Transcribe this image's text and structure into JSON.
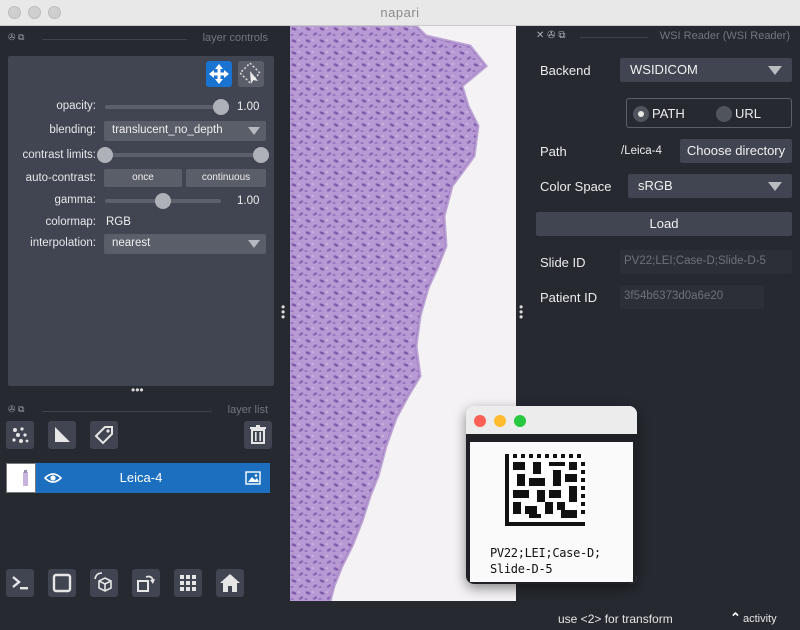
{
  "window": {
    "title": "napari"
  },
  "left_panel": {
    "layer_controls_title": "layer controls",
    "opacity": {
      "label": "opacity:",
      "value_text": "1.00",
      "value": 1.0
    },
    "blending": {
      "label": "blending:",
      "value": "translucent_no_depth"
    },
    "contrast_limits": {
      "label": "contrast limits:",
      "low": 0.0,
      "high": 1.0
    },
    "auto_contrast": {
      "label": "auto-contrast:",
      "once_label": "once",
      "continuous_label": "continuous"
    },
    "gamma": {
      "label": "gamma:",
      "value_text": "1.00",
      "value": 0.5
    },
    "colormap": {
      "label": "colormap:",
      "value": "RGB"
    },
    "interpolation": {
      "label": "interpolation:",
      "value": "nearest"
    },
    "layer_list_title": "layer list",
    "layers": [
      {
        "name": "Leica-4"
      }
    ]
  },
  "right_panel": {
    "title": "WSI Reader (WSI Reader)",
    "backend": {
      "label": "Backend",
      "value": "WSIDICOM"
    },
    "source_options": [
      {
        "label": "PATH",
        "selected": true
      },
      {
        "label": "URL",
        "selected": false
      }
    ],
    "path": {
      "label": "Path",
      "value": "/Leica-4",
      "button_label": "Choose directory"
    },
    "color_space": {
      "label": "Color Space",
      "value": "sRGB"
    },
    "load_button_label": "Load",
    "slide_id": {
      "label": "Slide ID",
      "value": "PV22;LEI;Case-D;Slide-D-5"
    },
    "patient_id": {
      "label": "Patient ID",
      "value": "3f54b6373d0a6e20"
    }
  },
  "status_bar": {
    "hint": "use <2> for transform",
    "activity_label": "activity"
  },
  "preview_window": {
    "label_line1": "PV22;LEI;Case-D;",
    "label_line2": "Slide-D-5"
  },
  "colors": {
    "accent": "#1b6fbe",
    "panel_bg": "#262930",
    "control_bg": "#414551",
    "tissue": "#b79ad3"
  }
}
